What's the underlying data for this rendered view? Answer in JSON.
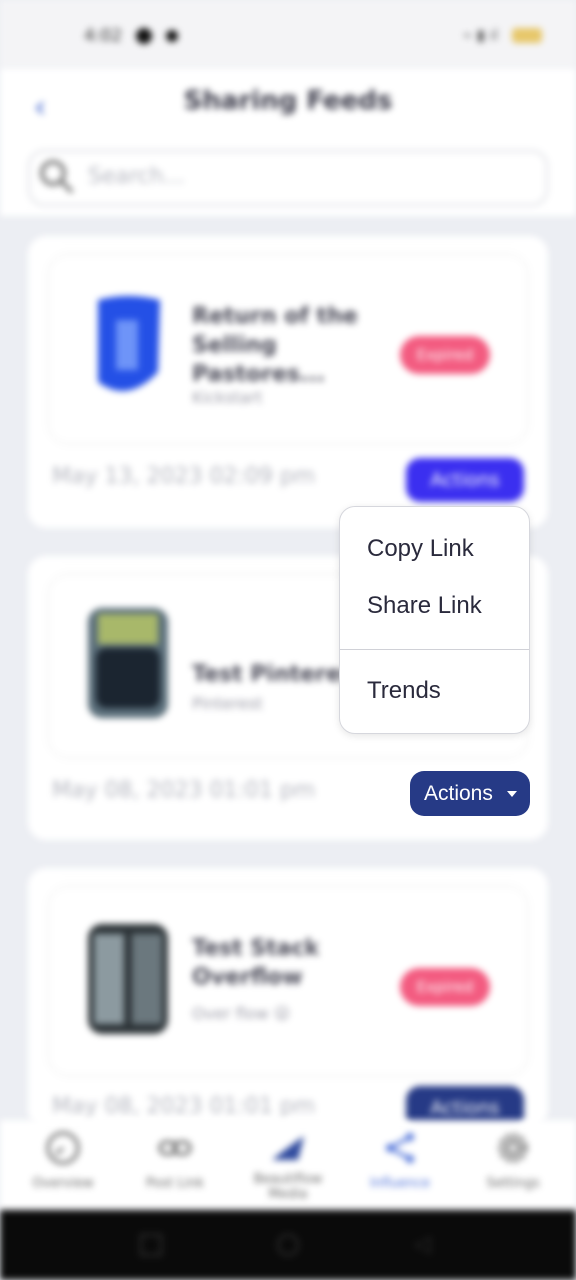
{
  "status_bar": {
    "time": "4:02"
  },
  "header": {
    "title": "Sharing Feeds"
  },
  "search": {
    "placeholder": "Search..."
  },
  "posts": [
    {
      "title": "Return of the Selling Pastores...",
      "source": "Kickstart",
      "badge": "Expired",
      "date": "May 13, 2023 02:09 pm",
      "action_label": "Actions"
    },
    {
      "title": "Test Pinterest",
      "source": "Pinterest",
      "badge": "",
      "date": "May 08, 2023 01:01 pm",
      "action_label": "Actions"
    },
    {
      "title": "Test Stack Overflow",
      "source": "Over flow 😜",
      "badge": "Expired",
      "date": "May 08, 2023 01:01 pm",
      "action_label": "Actions"
    }
  ],
  "actions_menu": {
    "items": [
      "Copy Link",
      "Share Link",
      "Trends"
    ]
  },
  "bottom_nav": [
    {
      "label": "Overview",
      "icon": "clock-icon"
    },
    {
      "label": "Post Link",
      "icon": "link-icon"
    },
    {
      "label": "Beautiflow Media",
      "icon": "wave-icon"
    },
    {
      "label": "Influence",
      "icon": "share-icon"
    },
    {
      "label": "Settings",
      "icon": "gear-icon"
    }
  ],
  "colors": {
    "accent": "#263a86",
    "accent_bright": "#3b2ff0",
    "expired": "#f35b80",
    "influence_active": "#4b6fd8"
  }
}
